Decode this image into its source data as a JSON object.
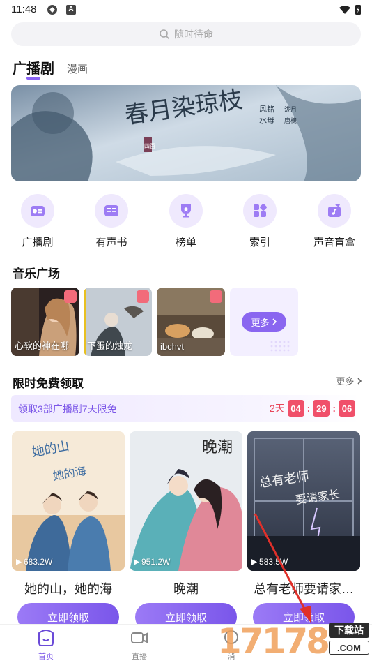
{
  "status_bar": {
    "time": "11:48",
    "a_label": "A"
  },
  "search": {
    "placeholder": "随时待命"
  },
  "top_tabs": {
    "active": "广播剧",
    "other": "漫画"
  },
  "banner": {
    "title": "春月染琼枝",
    "tag": "四百",
    "credit_1": "风铭",
    "credit_1b": "泷月",
    "credit_2": "水母",
    "credit_2b": "唐槐"
  },
  "categories": [
    {
      "label": "广播剧",
      "icon": "radio-icon"
    },
    {
      "label": "有声书",
      "icon": "book-icon"
    },
    {
      "label": "榜单",
      "icon": "trophy-icon"
    },
    {
      "label": "索引",
      "icon": "index-icon"
    },
    {
      "label": "声音盲盒",
      "icon": "blindbox-icon"
    }
  ],
  "music_section": {
    "title": "音乐广场",
    "cards": [
      {
        "caption": "心软的神在哪"
      },
      {
        "caption": "下蛋的烛龙"
      },
      {
        "caption": "ibchvt"
      }
    ],
    "more_label": "更多"
  },
  "free_section": {
    "title": "限时免费领取",
    "more_label": "更多",
    "promo_text": "领取3部广播剧7天限免",
    "countdown": {
      "days": "2天",
      "hours": "04",
      "minutes": "29",
      "seconds": "06",
      "sep": ":"
    },
    "books": [
      {
        "title": "她的山，她的海",
        "plays": "683.2W"
      },
      {
        "title": "晚潮",
        "plays": "951.2W"
      },
      {
        "title": "总有老师要请家…",
        "plays": "583.5W"
      }
    ],
    "claim_label": "立即领取"
  },
  "bottom_nav": [
    {
      "label": "首页",
      "icon": "home-icon",
      "active": true
    },
    {
      "label": "直播",
      "icon": "live-icon",
      "active": false
    },
    {
      "label": "消",
      "icon": "message-icon",
      "active": false
    }
  ],
  "watermark": {
    "digits": "17178",
    "top": "下载站",
    "bottom": ".COM"
  },
  "colors": {
    "accent": "#8a63f5",
    "countdown": "#f0506a",
    "arrow": "#e0302a"
  }
}
